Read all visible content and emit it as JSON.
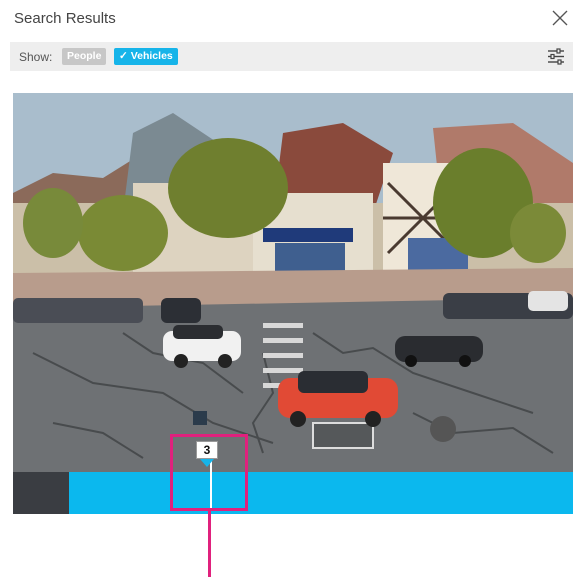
{
  "header": {
    "title": "Search Results",
    "close_icon": "close-icon"
  },
  "filter": {
    "show_label": "Show:",
    "people_label": "People",
    "vehicles_label": "✓ Vehicles",
    "settings_icon": "sliders-icon"
  },
  "video": {
    "marker_number": "3"
  },
  "colors": {
    "accent": "#16b4e9",
    "highlight": "#e0217d",
    "inactive_chip": "#c7c7c7",
    "timeline_dark": "#3a3d42"
  }
}
